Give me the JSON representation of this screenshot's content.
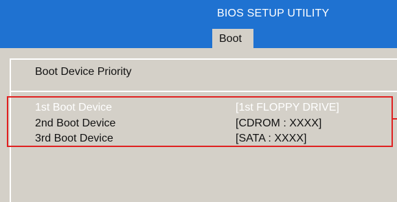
{
  "window": {
    "title": "BIOS  SETUP  UTILITY"
  },
  "menu": {
    "tabs": [
      {
        "label": "Boot",
        "active": true
      }
    ]
  },
  "section": {
    "title": "Boot Device Priority"
  },
  "boot_devices": [
    {
      "label": "1st Boot Device",
      "value": "[1st FLOPPY DRIVE]",
      "selected": true
    },
    {
      "label": "2nd Boot Device",
      "value": "[CDROM : XXXX]",
      "selected": false
    },
    {
      "label": "3rd Boot Device",
      "value": "[SATA : XXXX]",
      "selected": false
    }
  ],
  "colors": {
    "title_bar": "#1f72d1",
    "panel": "#d4d0c8",
    "highlight_border": "#e02020",
    "selected_text": "#ffffff",
    "normal_text": "#111111"
  }
}
